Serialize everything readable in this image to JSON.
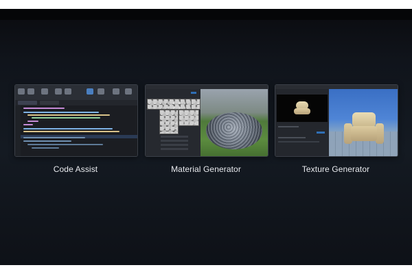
{
  "cards": [
    {
      "title": "Code Assist"
    },
    {
      "title": "Material Generator"
    },
    {
      "title": "Texture Generator"
    }
  ],
  "colors": {
    "background": "#141a22",
    "label": "#e8eaee",
    "accent": "#2f6fb5"
  }
}
